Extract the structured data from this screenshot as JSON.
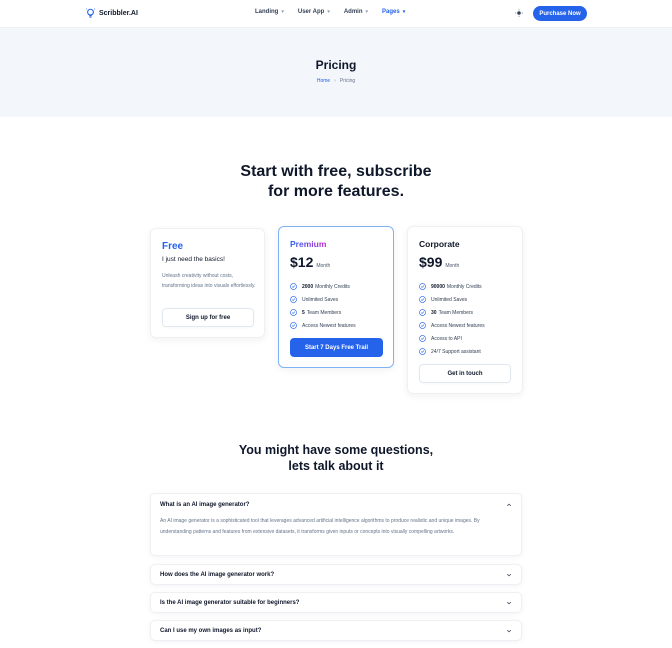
{
  "brand": {
    "name": "Scribbler.AI"
  },
  "nav": {
    "items": [
      {
        "label": "Landing"
      },
      {
        "label": "User App"
      },
      {
        "label": "Admin"
      },
      {
        "label": "Pages"
      }
    ],
    "purchase_label": "Purchase Now"
  },
  "hero": {
    "title": "Pricing",
    "breadcrumb": {
      "home": "Home",
      "current": "Pricing"
    }
  },
  "pricing": {
    "heading_line1": "Start with free, subscribe",
    "heading_line2": "for more features.",
    "free": {
      "name": "Free",
      "tagline": "I just need the basics!",
      "description": "Unleash creativity without costs, transforming ideas into visuals effortlessly.",
      "cta": "Sign up for free"
    },
    "premium": {
      "name": "Premium",
      "price": "$12",
      "period": "Month",
      "features": [
        {
          "bold": "2000",
          "text": "Monthly Credits"
        },
        {
          "bold": "",
          "text": "Unlimited Saves"
        },
        {
          "bold": "5",
          "text": "Team Members"
        },
        {
          "bold": "",
          "text": "Access Newest features"
        }
      ],
      "cta": "Start 7 Days Free Trail"
    },
    "corporate": {
      "name": "Corporate",
      "price": "$99",
      "period": "Month",
      "features": [
        {
          "bold": "90000",
          "text": "Monthly Credits"
        },
        {
          "bold": "",
          "text": "Unlimited Saves"
        },
        {
          "bold": "30",
          "text": "Team Members"
        },
        {
          "bold": "",
          "text": "Access Newest features"
        },
        {
          "bold": "",
          "text": "Access to API"
        },
        {
          "bold": "",
          "text": "24/7 Support assistant"
        }
      ],
      "cta": "Get in touch"
    }
  },
  "faq": {
    "heading_line1": "You might have some questions,",
    "heading_line2": "lets talk about it",
    "items": [
      {
        "question": "What is an AI image generator?",
        "answer": "An AI image generator is a sophisticated tool that leverages advanced artificial intelligence algorithms to produce realistic and unique images. By understanding patterns and features from extensive datasets, it transforms given inputs or concepts into visually compelling artworks."
      },
      {
        "question": "How does the AI image generator work?"
      },
      {
        "question": "Is the AI image generator suitable for beginners?"
      },
      {
        "question": "Can I use my own images as input?"
      }
    ]
  },
  "colors": {
    "primary": "#2563eb",
    "hero_bg": "#f3f6fa",
    "premium_gradient_start": "#2563eb",
    "premium_gradient_end": "#c026d3"
  }
}
